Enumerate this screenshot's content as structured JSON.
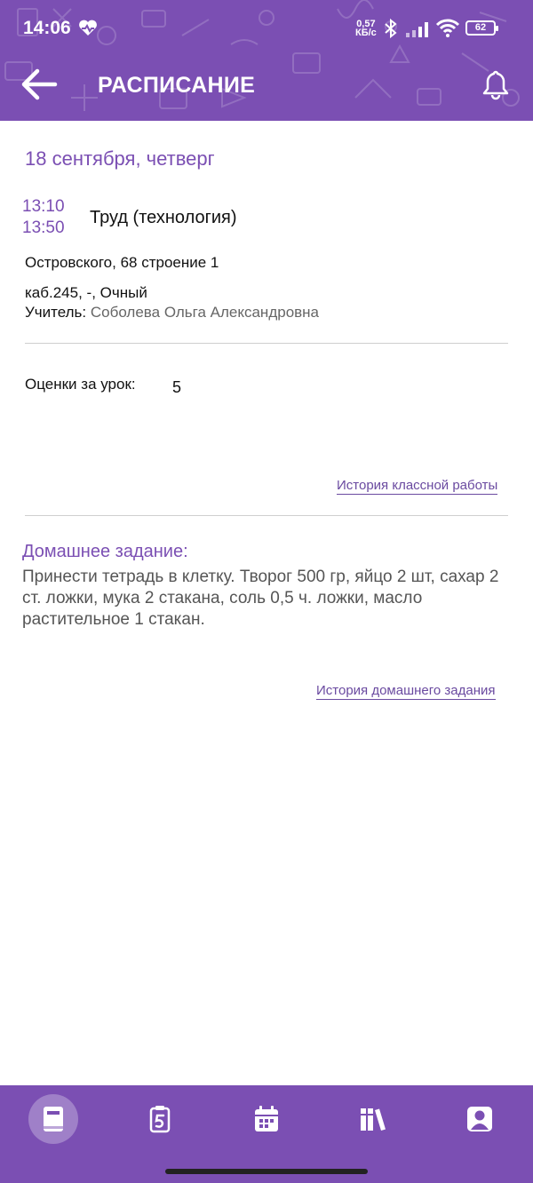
{
  "status_bar": {
    "time": "14:06",
    "net_speed_value": "0,57",
    "net_speed_unit": "КБ/с",
    "battery": "62"
  },
  "header": {
    "title": "РАСПИСАНИЕ",
    "icons": [
      "back-arrow-icon",
      "bell-icon"
    ],
    "background_color": "#7b4fb3"
  },
  "lesson": {
    "date": "18 сентября, четверг",
    "time_start": "13:10",
    "time_end": "13:50",
    "name": "Труд (технология)",
    "address": "Островского, 68 строение 1",
    "room": "каб.245, -, Очный",
    "teacher_label": "Учитель:",
    "teacher_name": "Соболева Ольга Александровна",
    "grades_label": "Оценки за урок:",
    "grade": "5",
    "class_history_link": "История классной работы"
  },
  "homework": {
    "title": "Домашнее задание:",
    "text": "Принести тетрадь в клетку. Творог 500 гр, яйцо 2 шт, сахар 2 ст. ложки, мука 2 стакана, соль 0,5 ч. ложки, масло растительное 1 стакан.",
    "history_link": "История домашнего задания"
  },
  "bottom_nav": {
    "items": [
      {
        "icon": "diary-book-icon",
        "active": true
      },
      {
        "icon": "grade-five-icon",
        "active": false
      },
      {
        "icon": "calendar-icon",
        "active": false
      },
      {
        "icon": "library-books-icon",
        "active": false
      },
      {
        "icon": "profile-icon",
        "active": false
      }
    ],
    "accent_color": "#7b4fb3"
  }
}
